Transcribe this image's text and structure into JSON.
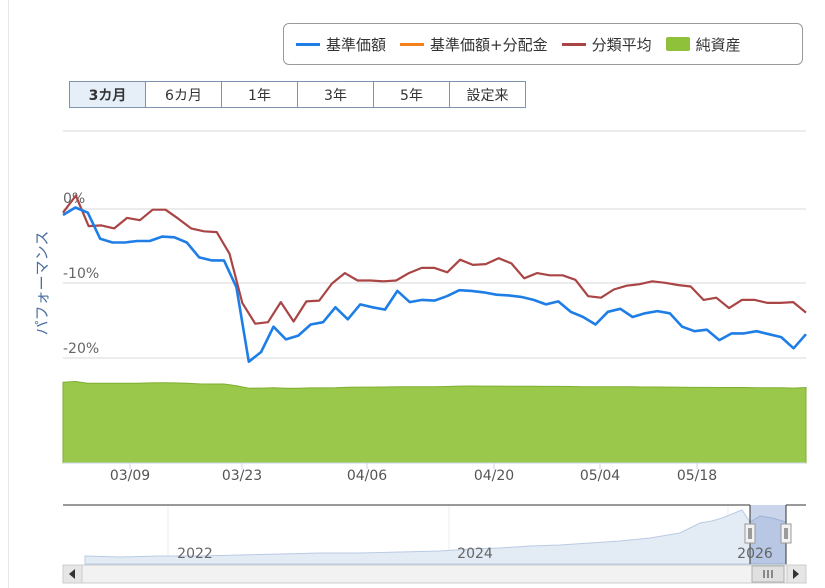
{
  "legend": [
    {
      "label": "基準価額",
      "color": "#1e7ee6",
      "kind": "line"
    },
    {
      "label": "基準価額+分配金",
      "color": "#f7821b",
      "kind": "line"
    },
    {
      "label": "分類平均",
      "color": "#aa4545",
      "kind": "line"
    },
    {
      "label": "純資産",
      "color": "#8fc13a",
      "kind": "area"
    }
  ],
  "range_buttons": [
    "3カ月",
    "6カ月",
    "1年",
    "3年",
    "5年",
    "設定来"
  ],
  "active_range": "3カ月",
  "chart_data": {
    "type": "line",
    "ylabel": "パフォーマンス",
    "y_ticks": [
      "0%",
      "-10%",
      "-20%"
    ],
    "y_tick_values": [
      0,
      -10,
      -20
    ],
    "ylim": [
      -21.5,
      11
    ],
    "x_ticks": [
      "03/09",
      "03/23",
      "04/06",
      "04/20",
      "05/04",
      "05/18"
    ],
    "grid": true,
    "series": [
      {
        "name": "基準価額",
        "color": "#1e7ee6",
        "values": [
          -0.8,
          0.2,
          -0.5,
          -4.0,
          -4.5,
          -4.5,
          -4.3,
          -4.3,
          -3.7,
          -3.8,
          -4.5,
          -6.5,
          -6.9,
          -6.9,
          -10.5,
          -20.5,
          -19.2,
          -15.8,
          -17.5,
          -17.0,
          -15.5,
          -15.2,
          -13.2,
          -14.8,
          -12.8,
          -13.2,
          -13.5,
          -11.0,
          -12.5,
          -12.2,
          -12.3,
          -11.7,
          -10.9,
          -11.0,
          -11.2,
          -11.5,
          -11.6,
          -11.8,
          -12.2,
          -12.8,
          -12.4,
          -13.8,
          -14.5,
          -15.5,
          -13.8,
          -13.4,
          -14.5,
          -14.0,
          -13.7,
          -14.0,
          -15.8,
          -16.4,
          -16.2,
          -17.6,
          -16.7,
          -16.7,
          -16.4,
          -16.8,
          -17.2,
          -18.7,
          -16.8
        ]
      },
      {
        "name": "分類平均",
        "color": "#aa4545",
        "values": [
          -0.5,
          1.8,
          -2.3,
          -2.2,
          -2.6,
          -1.2,
          -1.5,
          -0.1,
          -0.1,
          -1.3,
          -2.6,
          -3.0,
          -3.1,
          -6.0,
          -12.6,
          -15.4,
          -15.2,
          -12.5,
          -15.1,
          -12.4,
          -12.3,
          -10.0,
          -8.6,
          -9.6,
          -9.6,
          -9.7,
          -9.6,
          -8.6,
          -7.9,
          -7.9,
          -8.5,
          -6.8,
          -7.5,
          -7.4,
          -6.6,
          -7.3,
          -9.3,
          -8.6,
          -8.9,
          -8.9,
          -9.5,
          -11.7,
          -11.9,
          -10.8,
          -10.3,
          -10.1,
          -9.7,
          -9.9,
          -10.2,
          -10.4,
          -12.2,
          -11.9,
          -13.3,
          -12.2,
          -12.2,
          -12.6,
          -12.6,
          -12.5,
          -13.9
        ]
      }
    ],
    "net_assets_relative": [
      0.77,
      0.775,
      0.763,
      0.762,
      0.762,
      0.763,
      0.763,
      0.765,
      0.766,
      0.765,
      0.763,
      0.758,
      0.757,
      0.757,
      0.745,
      0.727,
      0.728,
      0.731,
      0.727,
      0.727,
      0.729,
      0.729,
      0.731,
      0.734,
      0.735,
      0.735,
      0.736,
      0.738,
      0.737,
      0.737,
      0.738,
      0.739,
      0.742,
      0.743,
      0.742,
      0.742,
      0.741,
      0.741,
      0.741,
      0.74,
      0.74,
      0.739,
      0.738,
      0.738,
      0.737,
      0.737,
      0.737,
      0.736,
      0.736,
      0.735,
      0.734,
      0.733,
      0.733,
      0.732,
      0.732,
      0.732,
      0.731,
      0.731,
      0.73,
      0.728,
      0.732
    ]
  },
  "navigator": {
    "year_labels": [
      "2022",
      "2024",
      "2026"
    ]
  }
}
